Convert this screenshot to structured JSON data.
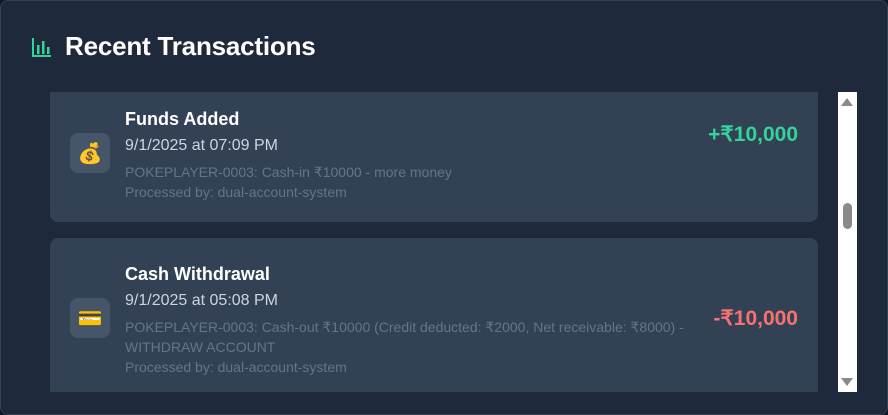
{
  "header": {
    "title": "Recent Transactions",
    "icon": "bar-chart-icon",
    "accent_color": "#34d399"
  },
  "transactions": [
    {
      "icon": "money-bag-icon",
      "glyph": "💰",
      "title": "Funds Added",
      "datetime": "9/1/2025 at 07:09 PM",
      "description": "POKEPLAYER-0003: Cash-in ₹10000 - more money",
      "processed_by": "Processed by: dual-account-system",
      "amount": "+₹10,000",
      "amount_color": "#34d399"
    },
    {
      "icon": "credit-card-icon",
      "glyph": "💳",
      "title": "Cash Withdrawal",
      "datetime": "9/1/2025 at 05:08 PM",
      "description": "POKEPLAYER-0003: Cash-out ₹10000 (Credit deducted: ₹2000, Net receivable: ₹8000) - WITHDRAW ACCOUNT",
      "processed_by": "Processed by: dual-account-system",
      "amount": "-₹10,000",
      "amount_color": "#f87171"
    }
  ]
}
